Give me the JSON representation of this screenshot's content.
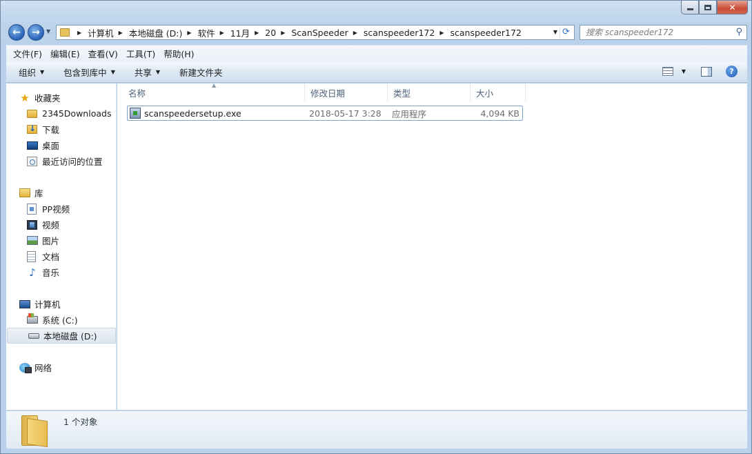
{
  "window": {
    "caption": {
      "minimize": "",
      "maximize": "",
      "close": ""
    }
  },
  "address": {
    "crumbs": [
      "计算机",
      "本地磁盘 (D:)",
      "软件",
      "11月",
      "20",
      "ScanSpeeder",
      "scanspeeder172",
      "scanspeeder172"
    ]
  },
  "search": {
    "placeholder": "搜索 scanspeeder172",
    "value": ""
  },
  "menu": {
    "file": "文件(F)",
    "edit": "编辑(E)",
    "view": "查看(V)",
    "tools": "工具(T)",
    "help": "帮助(H)"
  },
  "commands": {
    "organize": "组织",
    "include_library": "包含到库中",
    "share": "共享",
    "new_folder": "新建文件夹"
  },
  "nav": {
    "favorites": {
      "label": "收藏夹",
      "items": [
        "2345Downloads",
        "下载",
        "桌面",
        "最近访问的位置"
      ]
    },
    "libraries": {
      "label": "库",
      "items": [
        "PP视频",
        "视频",
        "图片",
        "文档",
        "音乐"
      ]
    },
    "computer": {
      "label": "计算机",
      "items": [
        "系统 (C:)",
        "本地磁盘 (D:)"
      ],
      "selected": "本地磁盘 (D:)"
    },
    "network": {
      "label": "网络"
    }
  },
  "columns": {
    "name": "名称",
    "modified": "修改日期",
    "type": "类型",
    "size": "大小"
  },
  "files": [
    {
      "name": "scanspeedersetup.exe",
      "modified": "2018-05-17 3:28",
      "type": "应用程序",
      "size": "4,094 KB"
    }
  ],
  "details": {
    "count": "1 个对象"
  },
  "colors": {
    "window_frame": "#bcd3ea",
    "selection_border": "#7da2ce",
    "accent": "#2a64b8"
  },
  "icons": [
    "back-arrow-icon",
    "forward-arrow-icon",
    "folder-icon",
    "refresh-icon",
    "search-icon",
    "star-icon",
    "download-folder-icon",
    "desktop-icon",
    "recent-places-icon",
    "library-icon",
    "video-icon",
    "picture-icon",
    "document-icon",
    "music-icon",
    "computer-icon",
    "system-drive-icon",
    "drive-icon",
    "network-icon",
    "exe-icon",
    "help-icon"
  ]
}
